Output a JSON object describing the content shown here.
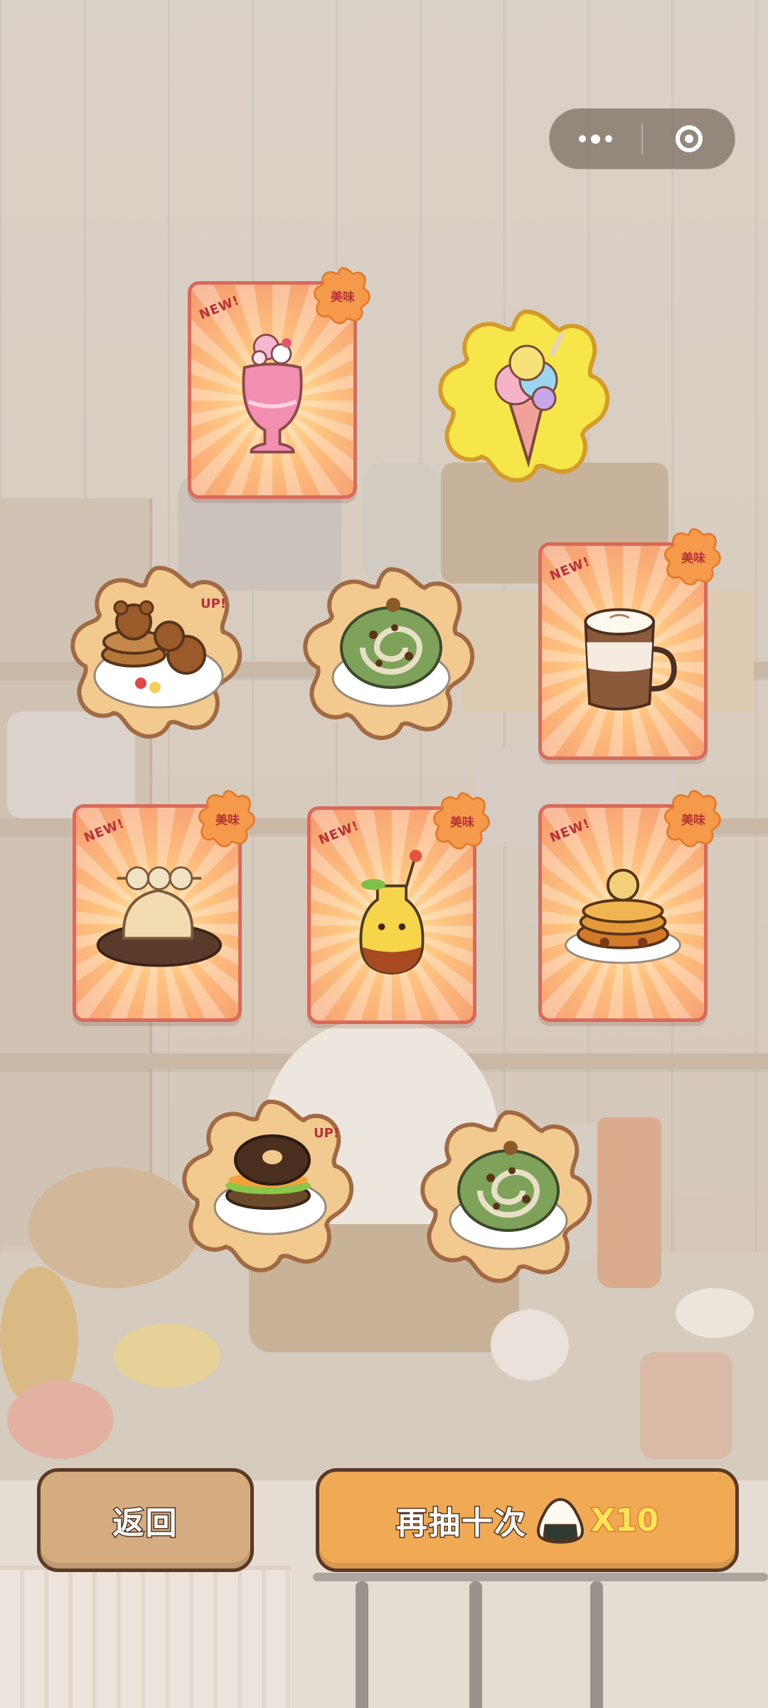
{
  "capsule": {
    "more_icon": "more-dots-icon",
    "close_icon": "target-close-icon"
  },
  "cards": [
    {
      "id": "pink-soda",
      "new_label": "NEW!",
      "badge_label": "美味"
    },
    {
      "id": "latte",
      "new_label": "NEW!",
      "badge_label": "美味"
    },
    {
      "id": "dango-cake",
      "new_label": "NEW!",
      "badge_label": "美味"
    },
    {
      "id": "lemon-drink",
      "new_label": "NEW!",
      "badge_label": "美味"
    },
    {
      "id": "pumpkin-pancake",
      "new_label": "NEW!",
      "badge_label": "美味"
    }
  ],
  "medallions": [
    {
      "id": "rainbow-ice-cream",
      "up_label": ""
    },
    {
      "id": "bear-pancakes",
      "up_label": "UP!"
    },
    {
      "id": "matcha-roll-1",
      "up_label": ""
    },
    {
      "id": "chocolate-donut-burger",
      "up_label": "UP!"
    },
    {
      "id": "matcha-roll-2",
      "up_label": ""
    }
  ],
  "buttons": {
    "back_label": "返回",
    "draw_label": "再抽十次",
    "draw_count": "X10",
    "draw_icon": "rice-ball-icon"
  },
  "colors": {
    "card_border": "#d96a5a",
    "badge_orange": "#f59a4a",
    "back_button": "#d4ac7f",
    "draw_button": "#f1aa54",
    "count_yellow": "#ffe45a"
  }
}
